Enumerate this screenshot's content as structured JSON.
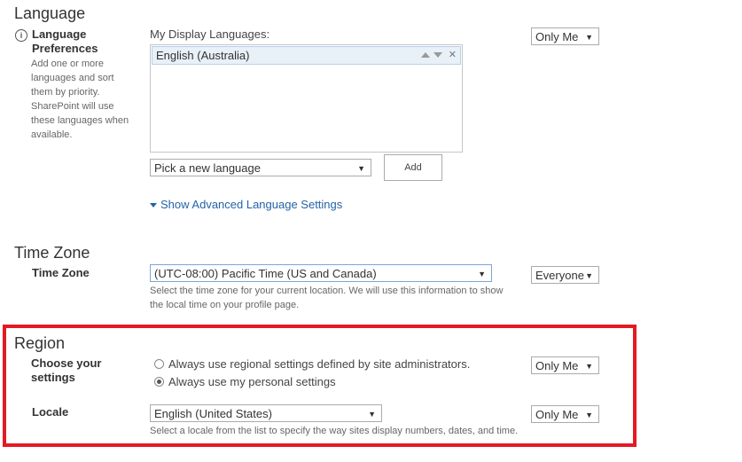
{
  "language": {
    "section_title": "Language",
    "label": "Language Preferences",
    "description": "Add one or more languages and sort them by priority. SharePoint will use these languages when available.",
    "display_languages_label": "My Display Languages:",
    "display_languages": [
      "English (Australia)"
    ],
    "pick_language_value": "Pick a new language",
    "add_button": "Add",
    "advanced_link": "Show Advanced Language Settings",
    "privacy_value": "Only Me"
  },
  "time_zone": {
    "section_title": "Time Zone",
    "label": "Time Zone",
    "value": "(UTC-08:00) Pacific Time (US and Canada)",
    "description": "Select the time zone for your current location. We will use this information to show the local time on your profile page.",
    "privacy_value": "Everyone"
  },
  "region": {
    "section_title": "Region",
    "choose_label": "Choose your settings",
    "options": [
      {
        "label": "Always use regional settings defined by site administrators.",
        "checked": false
      },
      {
        "label": "Always use my personal settings",
        "checked": true
      }
    ],
    "choose_privacy_value": "Only Me",
    "locale_label": "Locale",
    "locale_value": "English (United States)",
    "locale_description": "Select a locale from the list to specify the way sites display numbers, dates, and time.",
    "locale_privacy_value": "Only Me"
  },
  "colors": {
    "highlight": "#e31a23",
    "link": "#2563a8",
    "selected_item_bg": "#e8f0f8"
  },
  "icons": {
    "info": "info-icon",
    "dropdown": "chevron-down-icon",
    "expand": "triangle-down-icon"
  }
}
